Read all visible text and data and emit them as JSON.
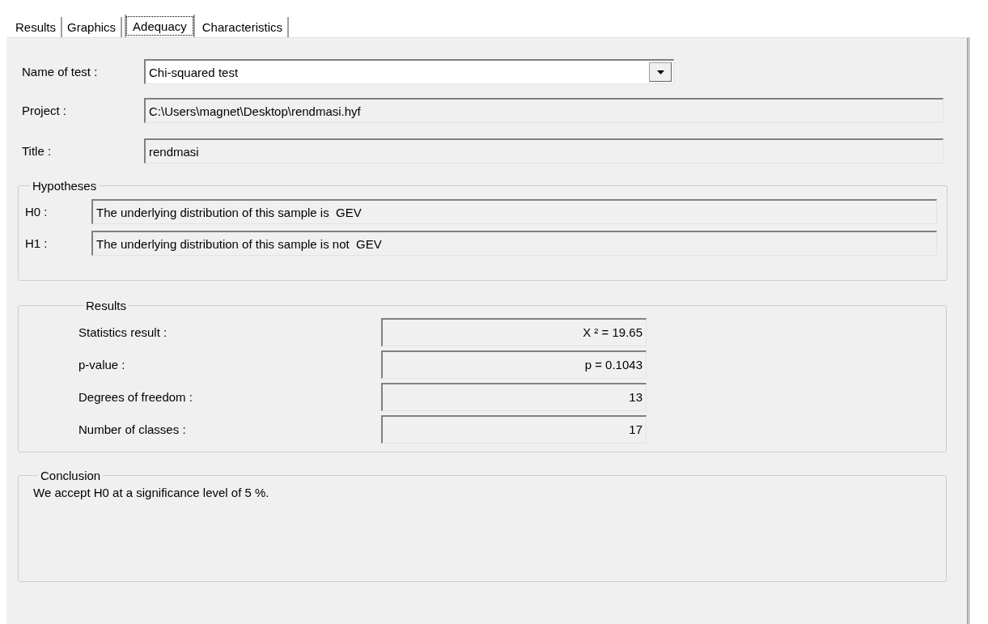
{
  "tabs": [
    {
      "label": "Results",
      "selected": false
    },
    {
      "label": "Graphics",
      "selected": false
    },
    {
      "label": "Adequacy",
      "selected": true
    },
    {
      "label": "Characteristics",
      "selected": false
    }
  ],
  "test": {
    "label": "Name of test :",
    "value": "Chi-squared test"
  },
  "fields": [
    {
      "label": "Project :",
      "value": "C:\\Users\\magnet\\Desktop\\rendmasi.hyf"
    },
    {
      "label": "Title :",
      "value": "rendmasi"
    }
  ],
  "hypotheses": {
    "heading": "Hypotheses",
    "rows": [
      {
        "label": "H0 :",
        "value": "The underlying distribution of this sample is  GEV"
      },
      {
        "label": "H1 :",
        "value": "The underlying distribution of this sample is not  GEV"
      }
    ]
  },
  "results": {
    "heading": "Results",
    "rows": [
      {
        "label": "Statistics result :",
        "value": "X ² = 19.65"
      },
      {
        "label": "p-value :",
        "value": "p = 0.1043"
      },
      {
        "label": "Degrees of freedom :",
        "value": "13"
      },
      {
        "label": "Number of classes :",
        "value": "17"
      }
    ]
  },
  "conclusion": {
    "heading": "Conclusion",
    "text": "We accept H0 at a significance level of 5 %."
  }
}
